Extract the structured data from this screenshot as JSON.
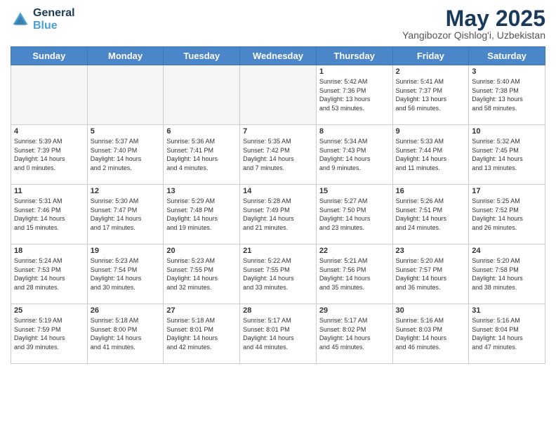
{
  "header": {
    "logo_general": "General",
    "logo_blue": "Blue",
    "month_title": "May 2025",
    "subtitle": "Yangibozor Qishlog'i, Uzbekistan"
  },
  "days_of_week": [
    "Sunday",
    "Monday",
    "Tuesday",
    "Wednesday",
    "Thursday",
    "Friday",
    "Saturday"
  ],
  "weeks": [
    [
      {
        "day": "",
        "info": ""
      },
      {
        "day": "",
        "info": ""
      },
      {
        "day": "",
        "info": ""
      },
      {
        "day": "",
        "info": ""
      },
      {
        "day": "1",
        "info": "Sunrise: 5:42 AM\nSunset: 7:36 PM\nDaylight: 13 hours\nand 53 minutes."
      },
      {
        "day": "2",
        "info": "Sunrise: 5:41 AM\nSunset: 7:37 PM\nDaylight: 13 hours\nand 56 minutes."
      },
      {
        "day": "3",
        "info": "Sunrise: 5:40 AM\nSunset: 7:38 PM\nDaylight: 13 hours\nand 58 minutes."
      }
    ],
    [
      {
        "day": "4",
        "info": "Sunrise: 5:39 AM\nSunset: 7:39 PM\nDaylight: 14 hours\nand 0 minutes."
      },
      {
        "day": "5",
        "info": "Sunrise: 5:37 AM\nSunset: 7:40 PM\nDaylight: 14 hours\nand 2 minutes."
      },
      {
        "day": "6",
        "info": "Sunrise: 5:36 AM\nSunset: 7:41 PM\nDaylight: 14 hours\nand 4 minutes."
      },
      {
        "day": "7",
        "info": "Sunrise: 5:35 AM\nSunset: 7:42 PM\nDaylight: 14 hours\nand 7 minutes."
      },
      {
        "day": "8",
        "info": "Sunrise: 5:34 AM\nSunset: 7:43 PM\nDaylight: 14 hours\nand 9 minutes."
      },
      {
        "day": "9",
        "info": "Sunrise: 5:33 AM\nSunset: 7:44 PM\nDaylight: 14 hours\nand 11 minutes."
      },
      {
        "day": "10",
        "info": "Sunrise: 5:32 AM\nSunset: 7:45 PM\nDaylight: 14 hours\nand 13 minutes."
      }
    ],
    [
      {
        "day": "11",
        "info": "Sunrise: 5:31 AM\nSunset: 7:46 PM\nDaylight: 14 hours\nand 15 minutes."
      },
      {
        "day": "12",
        "info": "Sunrise: 5:30 AM\nSunset: 7:47 PM\nDaylight: 14 hours\nand 17 minutes."
      },
      {
        "day": "13",
        "info": "Sunrise: 5:29 AM\nSunset: 7:48 PM\nDaylight: 14 hours\nand 19 minutes."
      },
      {
        "day": "14",
        "info": "Sunrise: 5:28 AM\nSunset: 7:49 PM\nDaylight: 14 hours\nand 21 minutes."
      },
      {
        "day": "15",
        "info": "Sunrise: 5:27 AM\nSunset: 7:50 PM\nDaylight: 14 hours\nand 23 minutes."
      },
      {
        "day": "16",
        "info": "Sunrise: 5:26 AM\nSunset: 7:51 PM\nDaylight: 14 hours\nand 24 minutes."
      },
      {
        "day": "17",
        "info": "Sunrise: 5:25 AM\nSunset: 7:52 PM\nDaylight: 14 hours\nand 26 minutes."
      }
    ],
    [
      {
        "day": "18",
        "info": "Sunrise: 5:24 AM\nSunset: 7:53 PM\nDaylight: 14 hours\nand 28 minutes."
      },
      {
        "day": "19",
        "info": "Sunrise: 5:23 AM\nSunset: 7:54 PM\nDaylight: 14 hours\nand 30 minutes."
      },
      {
        "day": "20",
        "info": "Sunrise: 5:23 AM\nSunset: 7:55 PM\nDaylight: 14 hours\nand 32 minutes."
      },
      {
        "day": "21",
        "info": "Sunrise: 5:22 AM\nSunset: 7:55 PM\nDaylight: 14 hours\nand 33 minutes."
      },
      {
        "day": "22",
        "info": "Sunrise: 5:21 AM\nSunset: 7:56 PM\nDaylight: 14 hours\nand 35 minutes."
      },
      {
        "day": "23",
        "info": "Sunrise: 5:20 AM\nSunset: 7:57 PM\nDaylight: 14 hours\nand 36 minutes."
      },
      {
        "day": "24",
        "info": "Sunrise: 5:20 AM\nSunset: 7:58 PM\nDaylight: 14 hours\nand 38 minutes."
      }
    ],
    [
      {
        "day": "25",
        "info": "Sunrise: 5:19 AM\nSunset: 7:59 PM\nDaylight: 14 hours\nand 39 minutes."
      },
      {
        "day": "26",
        "info": "Sunrise: 5:18 AM\nSunset: 8:00 PM\nDaylight: 14 hours\nand 41 minutes."
      },
      {
        "day": "27",
        "info": "Sunrise: 5:18 AM\nSunset: 8:01 PM\nDaylight: 14 hours\nand 42 minutes."
      },
      {
        "day": "28",
        "info": "Sunrise: 5:17 AM\nSunset: 8:01 PM\nDaylight: 14 hours\nand 44 minutes."
      },
      {
        "day": "29",
        "info": "Sunrise: 5:17 AM\nSunset: 8:02 PM\nDaylight: 14 hours\nand 45 minutes."
      },
      {
        "day": "30",
        "info": "Sunrise: 5:16 AM\nSunset: 8:03 PM\nDaylight: 14 hours\nand 46 minutes."
      },
      {
        "day": "31",
        "info": "Sunrise: 5:16 AM\nSunset: 8:04 PM\nDaylight: 14 hours\nand 47 minutes."
      }
    ]
  ]
}
